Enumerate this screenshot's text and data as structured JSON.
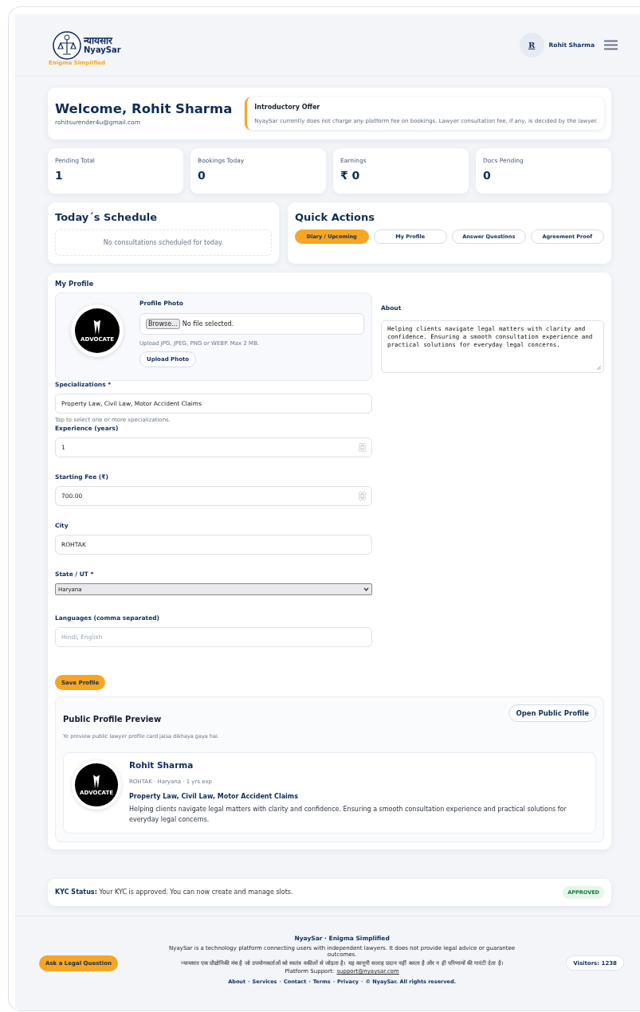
{
  "header": {
    "logo_hindi": "न्यायसार",
    "logo_name": "NyaySar",
    "logo_tagline": "Enigma Simplified",
    "avatar_initial": "R",
    "user_name": "Rohit Sharma"
  },
  "welcome": {
    "title": "Welcome, Rohit Sharma",
    "email": "rohitsurender4u@gmail.com",
    "offer_title": "Introductory Offer",
    "offer_text": "NyaySar currently does not charge any platform fee on bookings. Lawyer consultation fee, if any, is decided by the lawyer."
  },
  "stats": [
    {
      "label": "Pending Total",
      "value": "1"
    },
    {
      "label": "Bookings Today",
      "value": "0"
    },
    {
      "label": "Earnings",
      "value": "₹ 0"
    },
    {
      "label": "Docs Pending",
      "value": "0"
    }
  ],
  "schedule": {
    "title": "Today´s Schedule",
    "empty_text": "No consultations scheduled for today."
  },
  "quick_actions": {
    "title": "Quick Actions",
    "buttons": [
      {
        "label": "Diary / Upcoming",
        "selected": true
      },
      {
        "label": "My Profile",
        "selected": false
      },
      {
        "label": "Answer Questions",
        "selected": false
      },
      {
        "label": "Agreement Proof",
        "selected": false
      }
    ]
  },
  "profile": {
    "title": "My Profile",
    "photo_label": "Profile Photo",
    "browse_button": "Browse...",
    "file_status": "No file selected.",
    "photo_hint": "Upload JPG, JPEG, PNG or WEBP. Max 2 MB.",
    "upload_button": "Upload Photo",
    "avatar_caption": "ADVOCATE",
    "about_label": "About",
    "about_value": "Helping clients navigate legal matters with clarity and confidence. Ensuring a smooth consultation experience and practical solutions for everyday legal concerns.",
    "fields": [
      {
        "kind": "text",
        "label": "Specializations *",
        "value": "Property Law, Civil Law, Motor Accident Claims",
        "hint": "Tap to select one or more specializations."
      },
      {
        "kind": "number",
        "label": "Experience (years)",
        "value": "1"
      },
      {
        "kind": "number",
        "label": "Starting Fee (₹)",
        "value": "700.00"
      },
      {
        "kind": "text",
        "label": "City",
        "value": "ROHTAK"
      },
      {
        "kind": "select",
        "label": "State / UT *",
        "value": "Haryana"
      },
      {
        "kind": "text",
        "label": "Languages (comma separated)",
        "placeholder": "Hindi, English"
      }
    ],
    "save_button": "Save Profile"
  },
  "preview": {
    "title": "Public Profile Preview",
    "open_button": "Open Public Profile",
    "note": "Ye preview public lawyer profile card jaisa dikhaya gaya hai.",
    "name": "Rohit Sharma",
    "meta": "ROHTAK · Haryana · 1 yrs exp",
    "specializations": "Property Law, Civil Law, Motor Accident Claims",
    "about": "Helping clients navigate legal matters with clarity and confidence. Ensuring a smooth consultation experience and practical solutions for everyday legal concerns.",
    "avatar_caption": "ADVOCATE"
  },
  "kyc": {
    "label": "KYC Status:",
    "text": "Your KYC is approved. You can now create and manage slots.",
    "badge": "APPROVED"
  },
  "footer": {
    "ask_button": "Ask a Legal Question",
    "title": "NyaySar · Enigma Simplified",
    "disclaimer_en": "NyaySar is a technology platform connecting users with independent lawyers. It does not provide legal advice or guarantee outcomes.",
    "disclaimer_hi": "न्यायसार एक प्रौद्योगिकी मंच है जो उपयोगकर्ताओं को स्वतंत्र वकीलों से जोड़ता है। यह कानूनी सलाह प्रदान नहीं करता है और न ही परिणामों की गारंटी देता है।",
    "support_label": "Platform Support:",
    "support_email": "support@nyaysar.com",
    "links": [
      "About",
      "Services",
      "Contact",
      "Terms",
      "Privacy"
    ],
    "separator": "·",
    "copyright": "© NyaySar. All rights reserved.",
    "visitors": "Visitors: 1238"
  }
}
